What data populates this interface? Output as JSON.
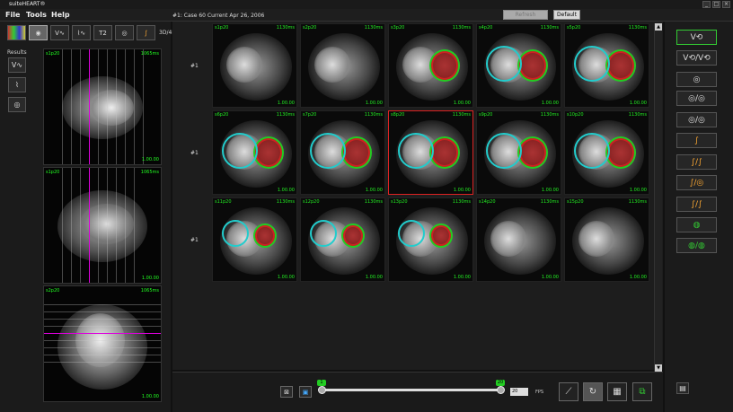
{
  "window": {
    "title": "suiteHEART®"
  },
  "menu": {
    "file": "File",
    "tools": "Tools",
    "help": "Help"
  },
  "header": {
    "case_info": "#1: Case 60 Current  Apr 26, 2006",
    "refresh_label": "Refresh",
    "default_label": "Default"
  },
  "left": {
    "toolbar_3d4d": "3D/4D",
    "toolbar_t2": "T2",
    "results_label": "Results",
    "views": [
      {
        "tl": "s1p20",
        "tr": "1065ms",
        "br": "1.00.00"
      },
      {
        "tl": "s1p20",
        "tr": "1065ms",
        "br": "1.00.00"
      },
      {
        "tl": "s2p20",
        "tr": "1065ms",
        "br": "1.00.00"
      }
    ]
  },
  "grid": {
    "row_labels": [
      "#1",
      "#1",
      "#1"
    ],
    "cells": [
      {
        "tl": "s1p20",
        "tr": "1130ms",
        "br": "1.00.00"
      },
      {
        "tl": "s2p20",
        "tr": "1130ms",
        "br": "1.00.00"
      },
      {
        "tl": "s3p20",
        "tr": "1130ms",
        "br": "1.00.00"
      },
      {
        "tl": "s4p20",
        "tr": "1130ms",
        "br": "1.00.00"
      },
      {
        "tl": "s5p20",
        "tr": "1130ms",
        "br": "1.00.00"
      },
      {
        "tl": "s6p20",
        "tr": "1130ms",
        "br": "1.00.00"
      },
      {
        "tl": "s7p20",
        "tr": "1130ms",
        "br": "1.00.00"
      },
      {
        "tl": "s8p20",
        "tr": "1130ms",
        "br": "1.00.00"
      },
      {
        "tl": "s9p20",
        "tr": "1130ms",
        "br": "1.00.00"
      },
      {
        "tl": "s10p20",
        "tr": "1130ms",
        "br": "1.00.00"
      },
      {
        "tl": "s11p20",
        "tr": "1130ms",
        "br": "1.00.00"
      },
      {
        "tl": "s12p20",
        "tr": "1130ms",
        "br": "1.00.00"
      },
      {
        "tl": "s13p20",
        "tr": "1130ms",
        "br": "1.00.00"
      },
      {
        "tl": "s14p20",
        "tr": "1130ms",
        "br": "1.00.00"
      },
      {
        "tl": "s15p20",
        "tr": "1130ms",
        "br": "1.00.00"
      }
    ]
  },
  "bottom": {
    "slider_start": "1",
    "slider_end": "20",
    "fps_value": "20",
    "fps_label": "FPS"
  },
  "colors": {
    "contour_green": "#22cc22",
    "contour_red": "#cc2222",
    "contour_cyan": "#22cccc",
    "selected_border": "#dd2222",
    "overlay_text": "#22ee22"
  },
  "icons": [
    "heart-icon",
    "volume-curve-icon",
    "flow-curve-icon",
    "ring-icon",
    "contour-icon",
    "cine-play-icon",
    "grid-layout-icon",
    "report-icon"
  ]
}
